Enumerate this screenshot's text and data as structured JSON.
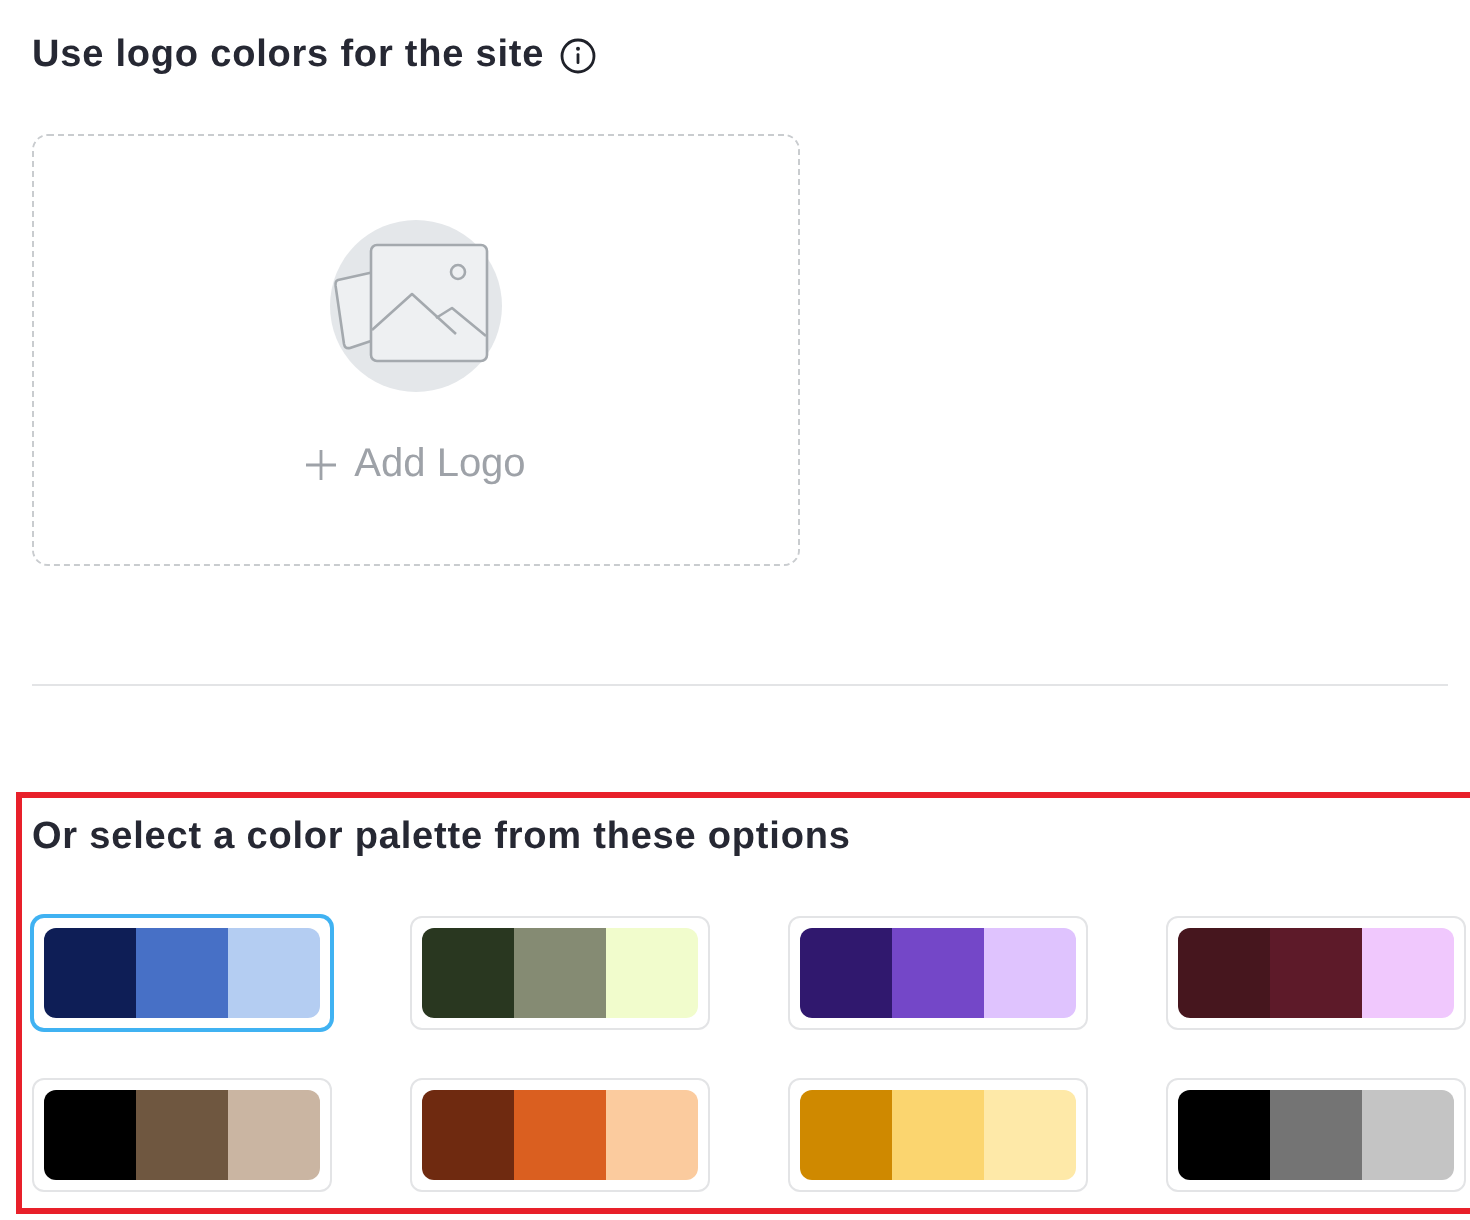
{
  "logo_section": {
    "title": "Use logo colors for the site",
    "upload_button": "Add Logo"
  },
  "palette_section": {
    "highlighted": true,
    "title": "Or select a color palette from these options",
    "palettes": [
      {
        "selected": true,
        "swatches": [
          {
            "color": "#0e1e56"
          },
          {
            "color": "#4770c6"
          },
          {
            "color": "#b4cdf2"
          }
        ]
      },
      {
        "selected": false,
        "swatches": [
          {
            "color": "#293720"
          },
          {
            "color": "#858b73"
          },
          {
            "color": "#f1fccc"
          }
        ]
      },
      {
        "selected": false,
        "swatches": [
          {
            "color": "#30186e"
          },
          {
            "color": "#7447c8"
          },
          {
            "color": "#dfc3fe"
          }
        ]
      },
      {
        "selected": false,
        "swatches": [
          {
            "color": "#46161e"
          },
          {
            "color": "#5d1a29"
          },
          {
            "color": "#f0c8fd"
          }
        ]
      },
      {
        "selected": false,
        "swatches": [
          {
            "color": "#000000"
          },
          {
            "color": "#6f5740"
          },
          {
            "color": "#cab5a2"
          }
        ]
      },
      {
        "selected": false,
        "swatches": [
          {
            "color": "#6f2a10"
          },
          {
            "color": "#da5f20"
          },
          {
            "color": "#fbcb9e"
          }
        ]
      },
      {
        "selected": false,
        "swatches": [
          {
            "color": "#cf8900"
          },
          {
            "color": "#fbd56f"
          },
          {
            "color": "#fee9a8"
          }
        ]
      },
      {
        "selected": false,
        "swatches": [
          {
            "color": "#000000"
          },
          {
            "color": "#747474"
          },
          {
            "color": "#c4c4c4"
          }
        ]
      }
    ]
  }
}
